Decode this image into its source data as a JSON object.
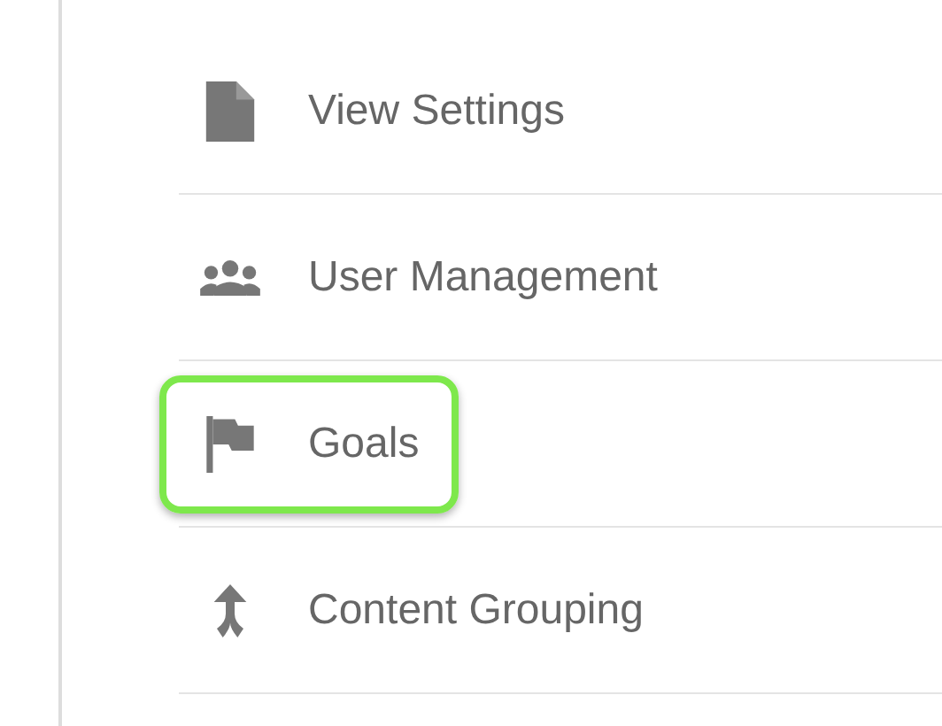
{
  "menu": {
    "items": [
      {
        "label": "View Settings",
        "highlighted": false
      },
      {
        "label": "User Management",
        "highlighted": false
      },
      {
        "label": "Goals",
        "highlighted": true
      },
      {
        "label": "Content Grouping",
        "highlighted": false
      }
    ]
  }
}
